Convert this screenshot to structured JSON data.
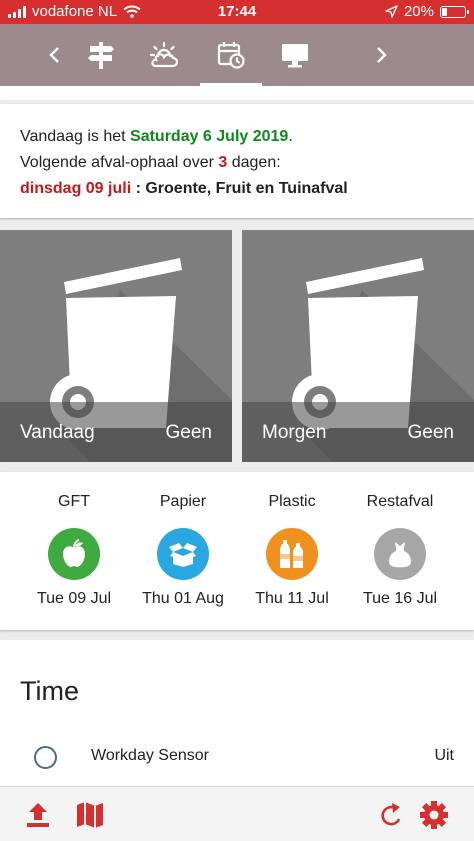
{
  "status_bar": {
    "carrier": "vodafone NL",
    "time": "17:44",
    "battery": "20%",
    "battery_level": 0.2
  },
  "tabs": [
    {
      "icon": "chevron-left-icon"
    },
    {
      "icon": "signpost-icon"
    },
    {
      "icon": "weather-icon"
    },
    {
      "icon": "calendar-clock-icon",
      "active": true
    },
    {
      "icon": "monitor-icon"
    },
    {
      "icon": "chevron-right-icon"
    }
  ],
  "info": {
    "line1_prefix": "Vandaag is het ",
    "today_date": "Saturday 6 July 2019",
    "line1_suffix": ".",
    "line2_prefix": "Volgende afval-ophaal over ",
    "days": "3",
    "line2_suffix": " dagen:",
    "next_date": "dinsdag 09 juli",
    "separator": " : ",
    "next_type": "Groente, Fruit en Tuinafval"
  },
  "bins": [
    {
      "day": "Vandaag",
      "value": "Geen"
    },
    {
      "day": "Morgen",
      "value": "Geen"
    }
  ],
  "schedule": [
    {
      "name": "GFT",
      "date": "Tue 09 Jul",
      "color": "#3faa3f",
      "icon": "apple-icon"
    },
    {
      "name": "Papier",
      "date": "Thu 01 Aug",
      "color": "#29a7e1",
      "icon": "box-icon"
    },
    {
      "name": "Plastic",
      "date": "Thu 11 Jul",
      "color": "#f0901e",
      "icon": "bottles-icon"
    },
    {
      "name": "Restafval",
      "date": "Tue 16 Jul",
      "color": "#a6a6a6",
      "icon": "trash-bag-icon"
    }
  ],
  "time_section": {
    "title": "Time",
    "sensor_label": "Workday Sensor",
    "sensor_state": "Uit"
  },
  "colors": {
    "status_bar": "#d62f2f",
    "tab_bar": "#9d8a8e",
    "accent_red": "#d62f2f",
    "date_green": "#0d8a1c",
    "highlight_red": "#c21b1b"
  }
}
